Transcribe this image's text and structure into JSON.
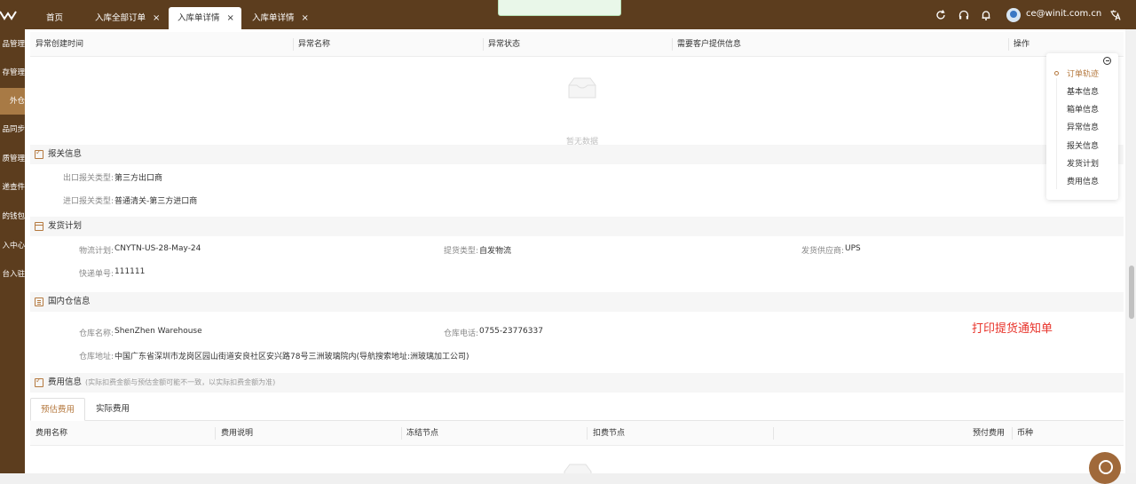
{
  "topbar": {
    "tabs": [
      {
        "label": "首页",
        "closable": false,
        "active": false
      },
      {
        "label": "入库全部订单",
        "closable": true,
        "active": false
      },
      {
        "label": "入库单详情",
        "closable": true,
        "active": true
      },
      {
        "label": "入库单详情",
        "closable": true,
        "active": false
      }
    ],
    "close_glyph": "×",
    "icons": [
      "refresh-icon",
      "headset-icon",
      "bell-icon",
      "translate-icon"
    ],
    "user_email": "ce@winit.com.cn",
    "accent_color": "#5c3d1e"
  },
  "sidebar": {
    "items": [
      {
        "label": "品管理",
        "active": false
      },
      {
        "label": "存管理",
        "active": false
      },
      {
        "label": "外仓",
        "active": true
      },
      {
        "label": "品同步",
        "active": false
      },
      {
        "label": "质管理",
        "active": false
      },
      {
        "label": "递查件",
        "active": false
      },
      {
        "label": "的钱包",
        "active": false
      },
      {
        "label": "入中心",
        "active": false
      },
      {
        "label": "台入驻",
        "active": false
      }
    ]
  },
  "exceptions": {
    "columns": [
      "异常创建时间",
      "异常名称",
      "异常状态",
      "需要客户提供信息",
      "操作"
    ],
    "empty_text": "暂无数据"
  },
  "customs": {
    "title": "报关信息",
    "fields": [
      {
        "label": "出口报关类型:",
        "value": "第三方出口商"
      },
      {
        "label": "进口报关类型:",
        "value": "普通清关-第三方进口商"
      }
    ]
  },
  "shipping_plan": {
    "title": "发货计划",
    "fields": [
      {
        "label": "物流计划:",
        "value": "CNYTN-US-28-May-24"
      },
      {
        "label": "提货类型:",
        "value": "自发物流"
      },
      {
        "label": "发货供应商:",
        "value": "UPS"
      },
      {
        "label": "快递单号:",
        "value": "111111"
      }
    ]
  },
  "warehouse": {
    "title": "国内仓信息",
    "fields": [
      {
        "label": "仓库名称:",
        "value": "ShenZhen Warehouse"
      },
      {
        "label": "仓库电话:",
        "value": "0755-23776337"
      },
      {
        "label": "仓库地址:",
        "value": "中国广东省深圳市龙岗区园山街道安良社区安兴路78号三洲玻璃院内(导航搜索地址:洲玻璃加工公司)"
      }
    ],
    "print_link": "打印提货通知单"
  },
  "fees": {
    "title": "费用信息",
    "note": "(实际扣费金额与预估金额可能不一致，以实际扣费金额为准)",
    "tabs": [
      {
        "label": "预估费用",
        "active": true
      },
      {
        "label": "实际费用",
        "active": false
      }
    ],
    "columns": [
      "费用名称",
      "费用说明",
      "冻结节点",
      "扣费节点",
      "预付费用",
      "币种"
    ]
  },
  "anchor_nav": {
    "items": [
      {
        "label": "订单轨迹",
        "active": true
      },
      {
        "label": "基本信息",
        "active": false
      },
      {
        "label": "箱单信息",
        "active": false
      },
      {
        "label": "异常信息",
        "active": false
      },
      {
        "label": "报关信息",
        "active": false
      },
      {
        "label": "发货计划",
        "active": false
      },
      {
        "label": "费用信息",
        "active": false
      }
    ]
  }
}
